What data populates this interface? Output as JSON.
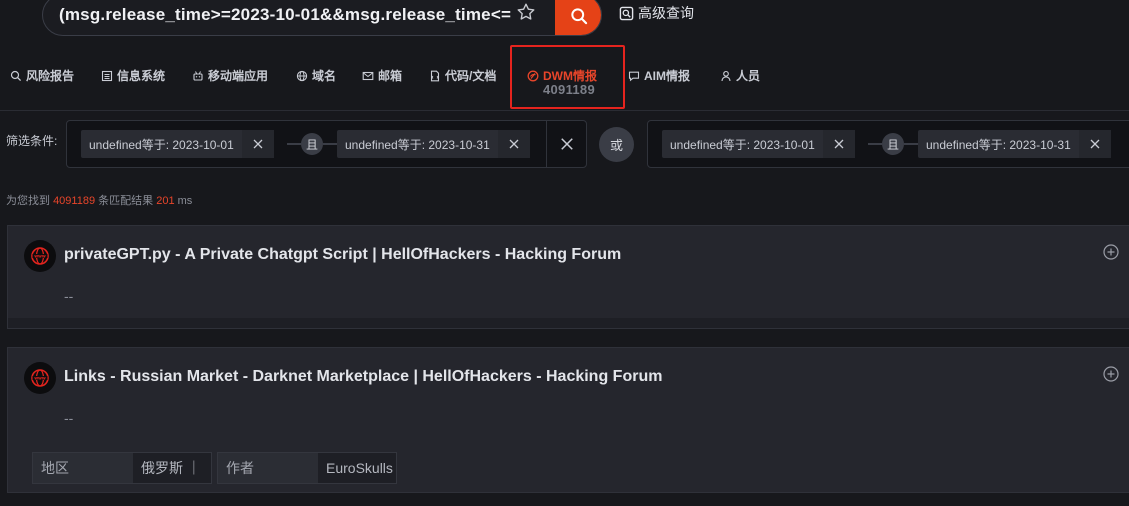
{
  "search": {
    "query": "(msg.release_time>=2023-10-01&&msg.release_time<=",
    "advanced_label": "高级查询"
  },
  "tabs": [
    {
      "label": "风险报告",
      "icon": "search-icon"
    },
    {
      "label": "信息系统",
      "icon": "list-icon"
    },
    {
      "label": "移动端应用",
      "icon": "robot-icon"
    },
    {
      "label": "域名",
      "icon": "globe-icon"
    },
    {
      "label": "邮箱",
      "icon": "mail-icon"
    },
    {
      "label": "代码/文档",
      "icon": "document-icon"
    },
    {
      "label": "DWM情报",
      "icon": "dwm-icon",
      "count": "4091189",
      "active": true
    },
    {
      "label": "AIM情报",
      "icon": "chat-icon"
    },
    {
      "label": "人员",
      "icon": "user-icon"
    }
  ],
  "filters": {
    "label": "筛选条件:",
    "and_label": "且",
    "or_label": "或",
    "groups": [
      {
        "chips": [
          "undefined等于: 2023-10-01",
          "undefined等于: 2023-10-31"
        ]
      },
      {
        "chips": [
          "undefined等于: 2023-10-01",
          "undefined等于: 2023-10-31"
        ]
      }
    ]
  },
  "summary": {
    "prefix": "为您找到",
    "count": "4091189",
    "middle": "条匹配结果",
    "time": "201",
    "unit": "ms"
  },
  "results": [
    {
      "title": "privateGPT.py - A Private Chatgpt Script | HellOfHackers - Hacking Forum",
      "desc": "--"
    },
    {
      "title": "Links - Russian Market - Darknet Marketplace | HellOfHackers - Hacking Forum",
      "desc": "--",
      "meta": [
        {
          "key": "地区",
          "value": "俄罗斯 ｜"
        },
        {
          "key": "作者",
          "value": "EuroSkulls"
        }
      ]
    }
  ],
  "colors": {
    "accent": "#e54217",
    "highlight_border": "#e5241e",
    "background": "#17181c",
    "card": "#25262d"
  }
}
